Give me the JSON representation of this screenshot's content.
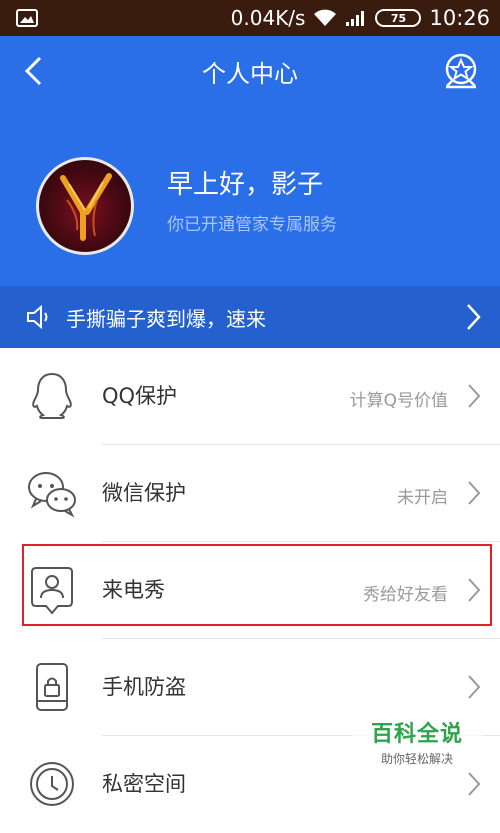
{
  "status_bar": {
    "net_speed": "0.04K/s",
    "battery": "75",
    "time": "10:26"
  },
  "header": {
    "title": "个人中心",
    "greeting": "早上好，影子",
    "subtitle": "你已开通管家专属服务"
  },
  "notice": {
    "text": "手撕骗子爽到爆，速来"
  },
  "menu": [
    {
      "label": "QQ保护",
      "status": "计算Q号价值",
      "icon": "qq-penguin-icon"
    },
    {
      "label": "微信保护",
      "status": "未开启",
      "icon": "wechat-icon"
    },
    {
      "label": "来电秀",
      "status": "秀给好友看",
      "icon": "caller-show-icon"
    },
    {
      "label": "手机防盗",
      "status": "",
      "icon": "phone-lock-icon"
    },
    {
      "label": "私密空间",
      "status": "",
      "icon": "private-space-icon"
    }
  ],
  "watermark": {
    "title": "百科全说",
    "subtitle": "助你轻松解决"
  },
  "colors": {
    "header_blue": "#2a6ee8",
    "banner_blue": "#2560cf",
    "highlight_red": "#e0202a"
  }
}
